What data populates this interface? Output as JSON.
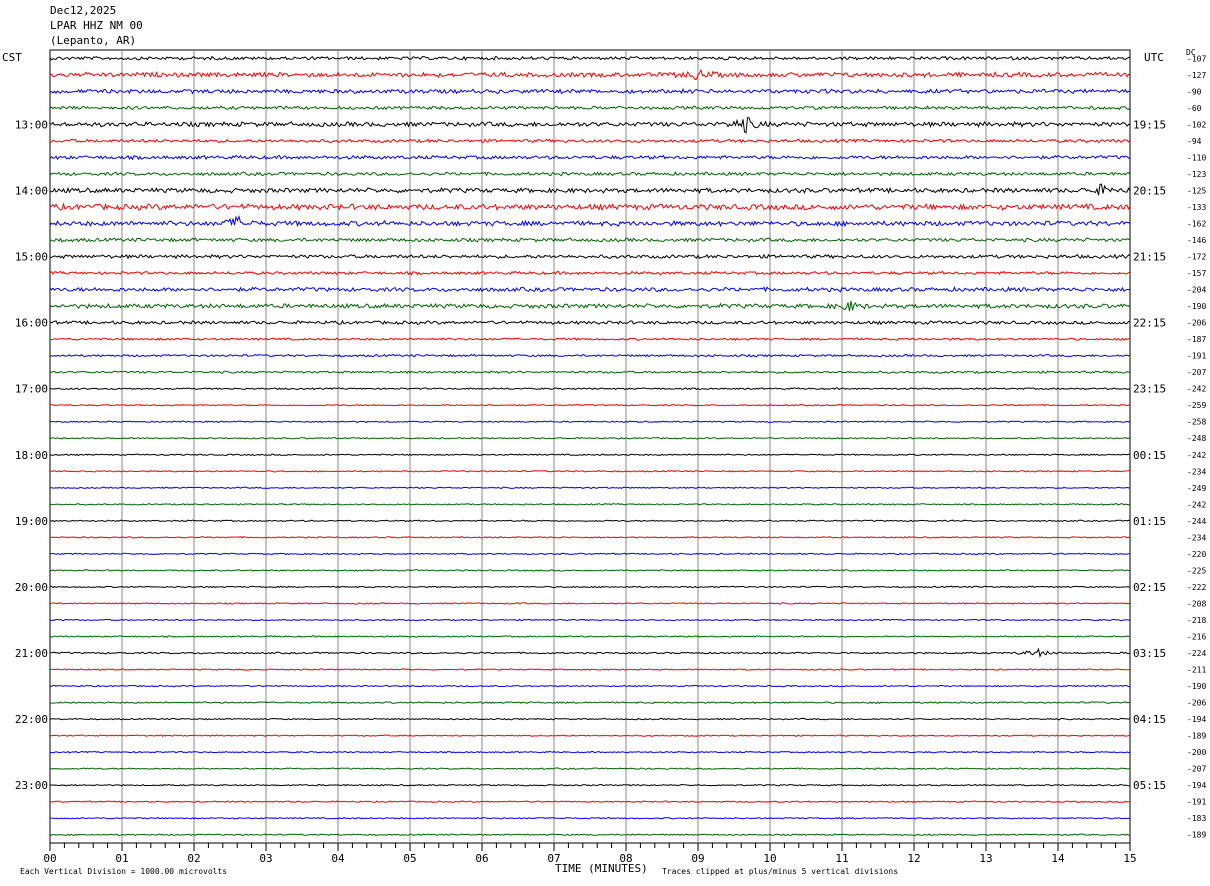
{
  "header": {
    "date": "Dec12,2025",
    "station": "LPAR HHZ NM 00",
    "location": "(Lepanto, AR)"
  },
  "left_tz": "CST",
  "right_tz": "UTC",
  "dc_label": "DC",
  "footer": {
    "scale_note": "Each Vertical Division = 1000.00 microvolts",
    "clip_note": "Traces clipped at plus/minus 5 vertical divisions",
    "x_title": "TIME (MINUTES)"
  },
  "colors": {
    "trace_cycle": [
      "#000000",
      "#ff0000",
      "#0000ff",
      "#006400"
    ],
    "grid": "#888888"
  },
  "chart_data": {
    "type": "line",
    "xlabel": "TIME (MINUTES)",
    "xlim": [
      0,
      15
    ],
    "x_ticks": [
      "00",
      "01",
      "02",
      "03",
      "04",
      "05",
      "06",
      "07",
      "08",
      "09",
      "10",
      "11",
      "12",
      "13",
      "14",
      "15"
    ],
    "left_hour_labels": [
      "13:00",
      "14:00",
      "15:00",
      "16:00",
      "17:00",
      "18:00",
      "19:00",
      "20:00",
      "21:00",
      "22:00",
      "23:00"
    ],
    "right_hour_labels": [
      "19:15",
      "20:15",
      "21:15",
      "22:15",
      "23:15",
      "00:15",
      "01:15",
      "02:15",
      "03:15",
      "04:15",
      "05:15"
    ],
    "dc_offsets": [
      -107,
      -127,
      -90,
      -60,
      -102,
      -94,
      -110,
      -123,
      -125,
      -133,
      -162,
      -146,
      -172,
      -157,
      -204,
      -190,
      -206,
      -187,
      -191,
      -207,
      -242,
      -259,
      -258,
      -248,
      -242,
      -234,
      -249,
      -242,
      -244,
      -234,
      -220,
      -225,
      -222,
      -208,
      -218,
      -216,
      -224,
      -211,
      -190,
      -206,
      -194,
      -189,
      -200,
      -207,
      -194,
      -191,
      -183,
      -189
    ],
    "trace_amplitude_divs": [
      1.2,
      1.7,
      1.5,
      1.2,
      1.7,
      1.2,
      1.3,
      1.2,
      1.7,
      2.1,
      1.8,
      1.3,
      1.3,
      1.1,
      1.5,
      1.6,
      1.2,
      0.8,
      0.8,
      0.8,
      0.6,
      0.5,
      0.5,
      0.5,
      0.5,
      0.5,
      0.5,
      0.5,
      0.5,
      0.5,
      0.5,
      0.5,
      0.5,
      0.5,
      0.5,
      0.5,
      0.6,
      0.5,
      0.5,
      0.6,
      0.5,
      0.5,
      0.5,
      0.5,
      0.5,
      0.5,
      0.5,
      0.5
    ],
    "events": [
      {
        "trace": 1,
        "minute": 9.0,
        "amp_divs": 3
      },
      {
        "trace": 4,
        "minute": 9.65,
        "amp_divs": 5
      },
      {
        "trace": 8,
        "minute": 14.6,
        "amp_divs": 3
      },
      {
        "trace": 10,
        "minute": 2.6,
        "amp_divs": 4
      },
      {
        "trace": 15,
        "minute": 11.1,
        "amp_divs": 3
      },
      {
        "trace": 36,
        "minute": 13.7,
        "amp_divs": 3
      }
    ]
  }
}
